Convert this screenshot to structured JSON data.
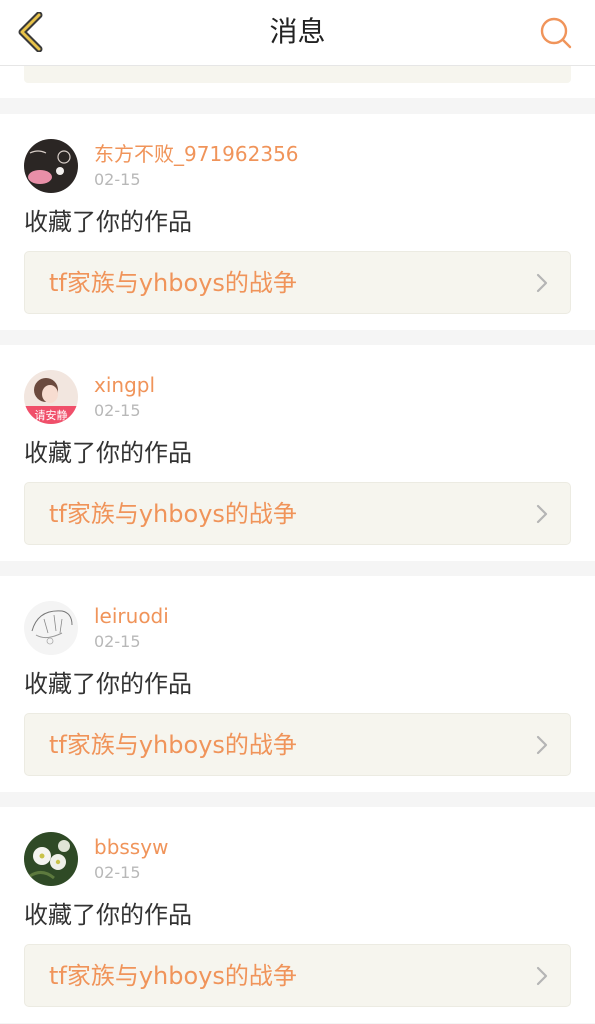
{
  "header": {
    "title": "消息"
  },
  "notifications": [
    {
      "username": "东方不败_971962356",
      "date": "02-15",
      "action": "收藏了你的作品",
      "work_title": "tf家族与yhboys的战争"
    },
    {
      "username": "xingpl",
      "date": "02-15",
      "action": "收藏了你的作品",
      "work_title": "tf家族与yhboys的战争",
      "avatar_text": "请安静"
    },
    {
      "username": "leiruodi",
      "date": "02-15",
      "action": "收藏了你的作品",
      "work_title": "tf家族与yhboys的战争"
    },
    {
      "username": "bbssyw",
      "date": "02-15",
      "action": "收藏了你的作品",
      "work_title": "tf家族与yhboys的战争"
    }
  ],
  "colors": {
    "accent": "#f0945a",
    "link_bg": "#f6f5ee",
    "divider_bg": "#f5f5f5"
  },
  "icons": {
    "back": "chevron-left-icon",
    "search": "search-icon",
    "chevron": "chevron-right-icon"
  }
}
